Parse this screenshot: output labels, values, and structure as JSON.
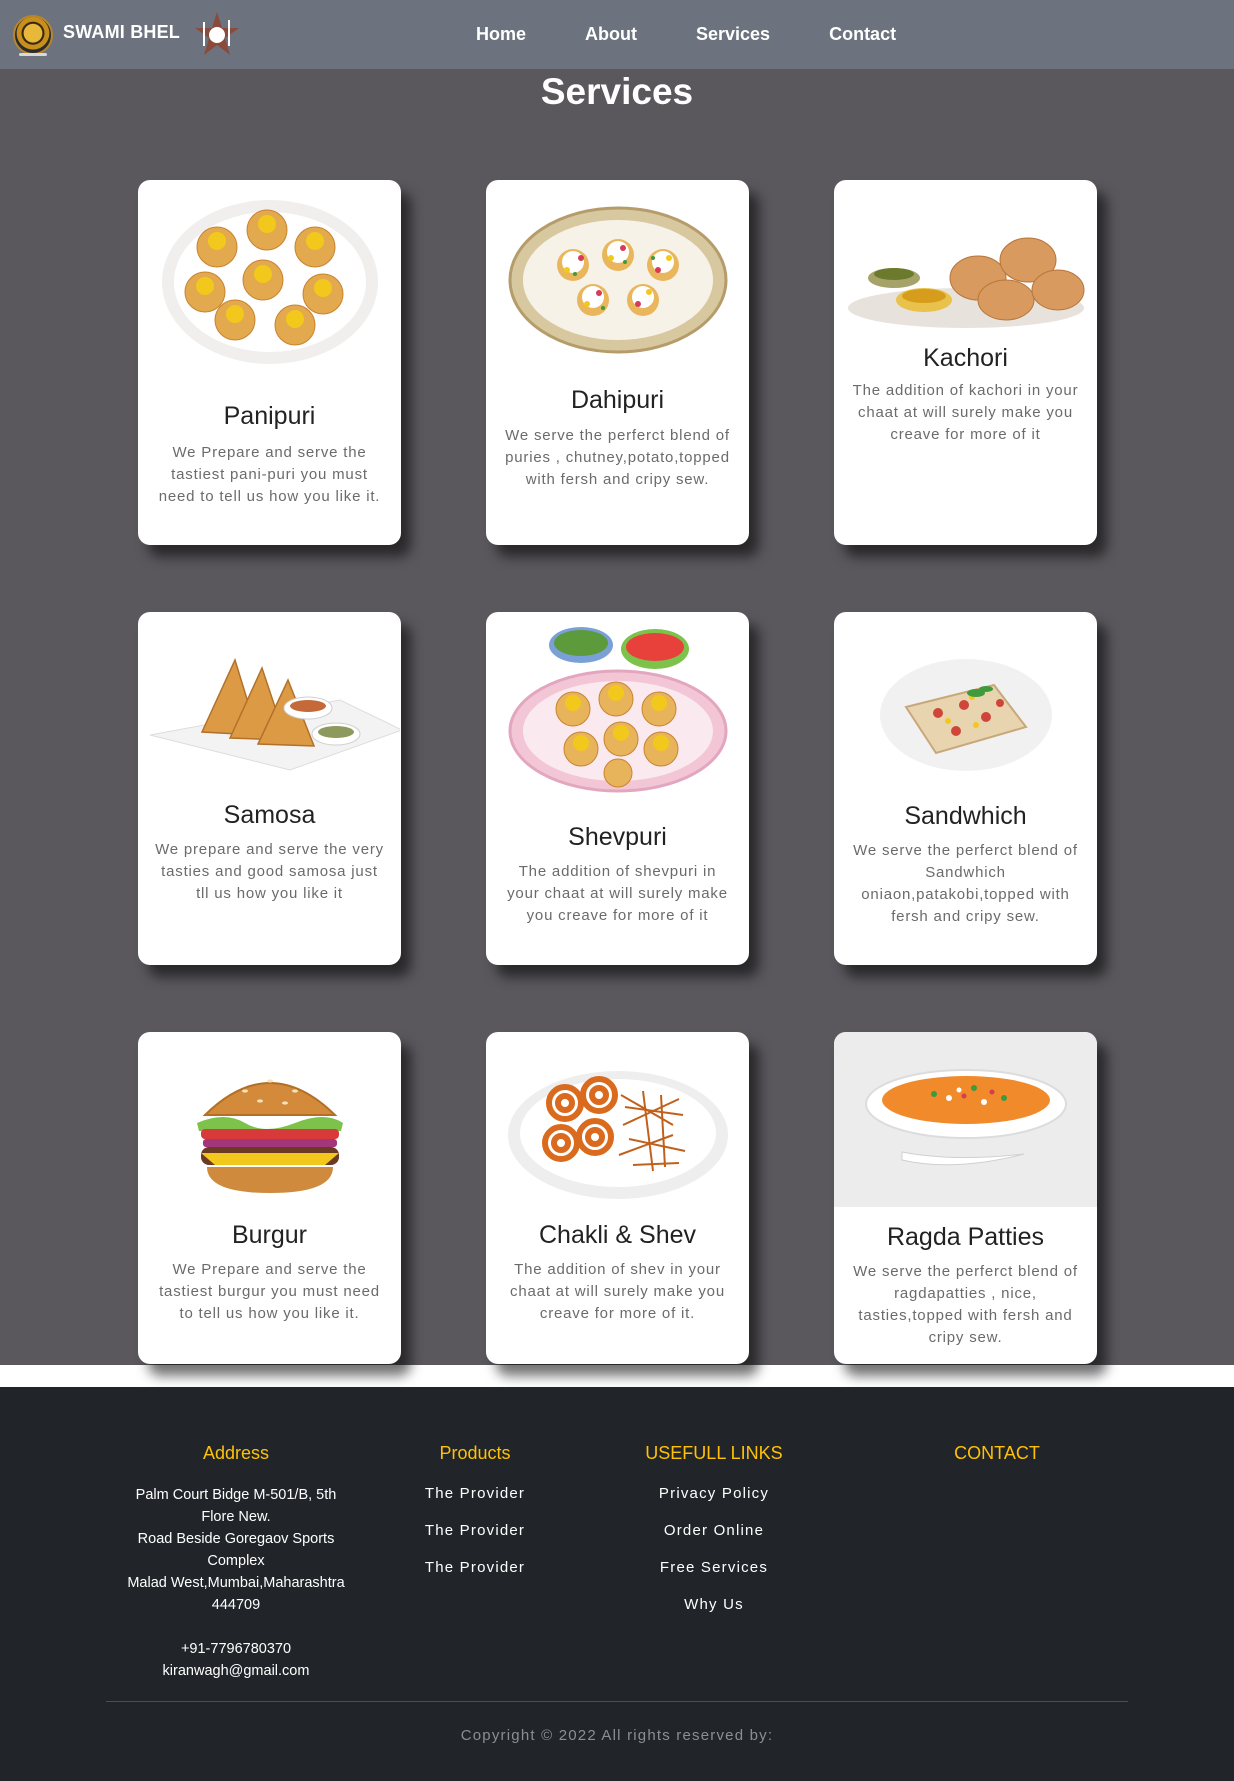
{
  "navbar": {
    "brand_name": "SWAMI BHEL",
    "links": [
      {
        "label": "Home"
      },
      {
        "label": "About"
      },
      {
        "label": "Services"
      },
      {
        "label": "Contact"
      }
    ]
  },
  "services": {
    "title": "Services",
    "cards": [
      {
        "title": "Panipuri",
        "text": "We Prepare and serve the tastiest pani-puri you must need to tell us how you like it.",
        "icon": "panipuri-image"
      },
      {
        "title": "Dahipuri",
        "text": "We serve the perferct blend of puries , chutney,potato,topped with fersh and cripy sew.",
        "icon": "dahipuri-image"
      },
      {
        "title": "Kachori",
        "text": "The addition of kachori in your chaat at will surely make you creave for more of it",
        "icon": "kachori-image"
      },
      {
        "title": "Samosa",
        "text": "We prepare and serve the very tasties and good samosa just tll us how you like it",
        "icon": "samosa-image"
      },
      {
        "title": "Shevpuri",
        "text": "The addition of shevpuri in your chaat at will surely make you creave for more of it",
        "icon": "shevpuri-image"
      },
      {
        "title": "Sandwhich",
        "text": "We serve the perferct blend of Sandwhich oniaon,patakobi,topped with fersh and cripy sew.",
        "icon": "sandwich-image"
      },
      {
        "title": "Burgur",
        "text": "We Prepare and serve the tastiest burgur you must need to tell us how you like it.",
        "icon": "burger-image"
      },
      {
        "title": "Chakli & Shev",
        "text": "The addition of shev in your chaat at will surely make you creave for more of it.",
        "icon": "chakli-shev-image"
      },
      {
        "title": "Ragda Patties",
        "text": "We serve the perferct blend of ragdapatties , nice, tasties,topped with fersh and cripy sew.",
        "icon": "ragda-patties-image"
      }
    ]
  },
  "footer": {
    "address": {
      "heading": "Address",
      "line1": "Palm Court Bidge M-501/B, 5th",
      "line2": "Flore New.",
      "line3": "Road Beside Goregaov Sports",
      "line4": "Complex",
      "line5": "Malad West,Mumbai,Maharashtra",
      "line6": "444709",
      "phone": "+91-7796780370",
      "email": "kiranwagh@gmail.com"
    },
    "products": {
      "heading": "Products",
      "items": [
        "The Provider",
        "The Provider",
        "The Provider"
      ]
    },
    "useful_links": {
      "heading": "USEFULL LINKS",
      "items": [
        "Privacy Policy",
        "Order Online",
        "Free Services",
        "Why Us"
      ]
    },
    "contact": {
      "heading": "CONTACT"
    },
    "copyright": "Copyright © 2022 All rights reserved by:"
  },
  "colors": {
    "navbar_bg": "#6c737e",
    "main_bg": "#5a585d",
    "footer_bg": "#212529",
    "footer_heading": "#ffc107"
  }
}
